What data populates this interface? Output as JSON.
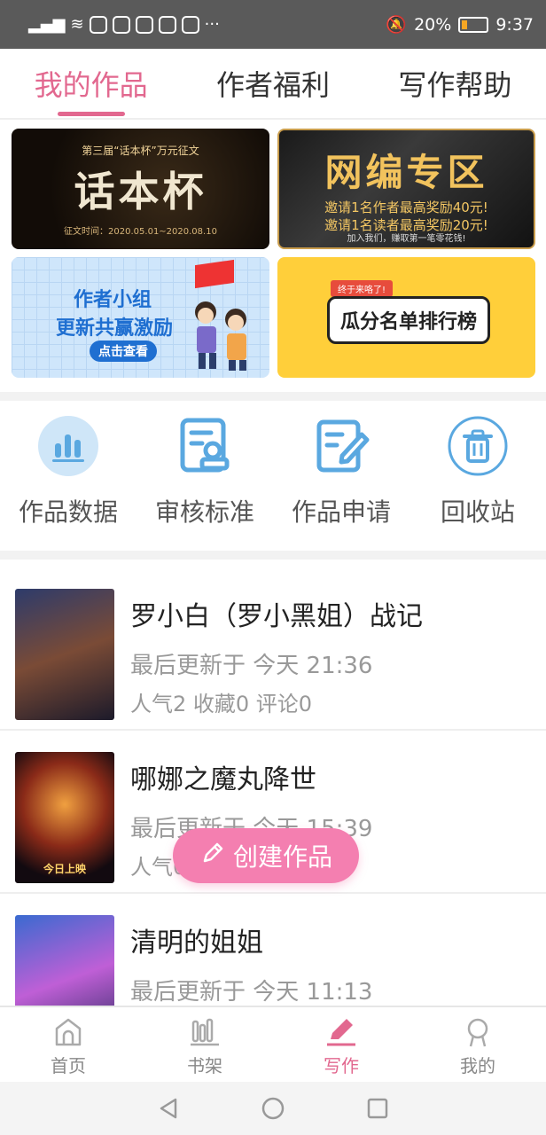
{
  "status_bar": {
    "battery": "20%",
    "time": "9:37",
    "dots": "···"
  },
  "tabs": [
    {
      "label": "我的作品",
      "active": true
    },
    {
      "label": "作者福利",
      "active": false
    },
    {
      "label": "写作帮助",
      "active": false
    }
  ],
  "banners": {
    "b1": {
      "top": "第三届“话本杯”万元征文",
      "main": "话本杯",
      "bottom": "征文时间：2020.05.01~2020.08.10"
    },
    "b2": {
      "main": "网编专区",
      "line1": "邀请1名作者最高奖励40元!",
      "line2": "邀请1名读者最高奖励20元!",
      "footer": "加入我们，赚取第一笔零花钱!"
    },
    "b3": {
      "line1": "作者小组",
      "line2": "更新共赢激励",
      "button": "点击查看"
    },
    "b4": {
      "tag": "终于来咯了!",
      "main": "瓜分名单排行榜"
    }
  },
  "tools": [
    {
      "label": "作品数据",
      "icon": "bar-chart-icon"
    },
    {
      "label": "审核标准",
      "icon": "review-standard-icon"
    },
    {
      "label": "作品申请",
      "icon": "edit-document-icon"
    },
    {
      "label": "回收站",
      "icon": "trash-icon"
    }
  ],
  "works": [
    {
      "title": "罗小白（罗小黑姐）战记",
      "updated": "最后更新于 今天 21:36",
      "stats": "人气2 收藏0 评论0",
      "badge": ""
    },
    {
      "title": "哪娜之魔丸降世",
      "updated": "最后更新于 今天 15:39",
      "stats": "人气0 收藏0 评论0",
      "badge": "今日上映"
    },
    {
      "title": "清明的姐姐",
      "updated": "最后更新于 今天 11:13",
      "stats": "",
      "badge": ""
    }
  ],
  "fab": {
    "label": "创建作品"
  },
  "bottom_nav": [
    {
      "label": "首页",
      "icon": "home-icon",
      "active": false
    },
    {
      "label": "书架",
      "icon": "bookshelf-icon",
      "active": false
    },
    {
      "label": "写作",
      "icon": "pen-icon",
      "active": true
    },
    {
      "label": "我的",
      "icon": "profile-icon",
      "active": false
    }
  ],
  "colors": {
    "accent": "#e2688f",
    "tool_blue": "#5aa8e0",
    "fab": "#f47fb0"
  }
}
